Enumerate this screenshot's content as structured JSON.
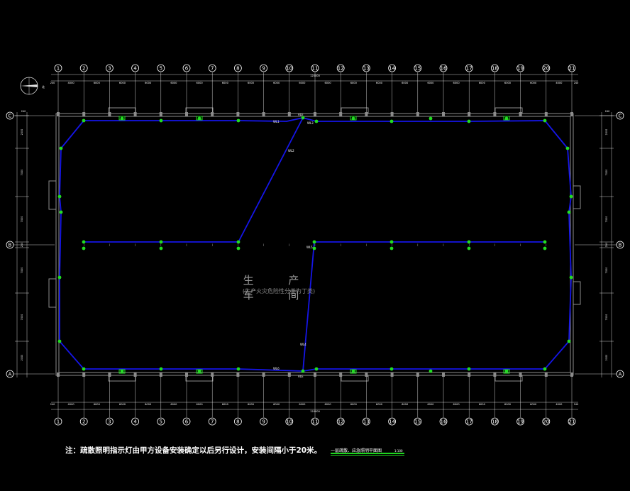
{
  "drawing": {
    "room_name": "生 产 车 间",
    "room_note": "(生产火灾危险性分类为丁类)",
    "note": "注：疏散照明指示灯由甲方设备安装确定以后另行设计，安装间隔小于20米。",
    "drawing_title": "一层疏散、应急照明平面图",
    "scale": "1:100",
    "north_label": "北"
  },
  "grid": {
    "columns": [
      "1",
      "2",
      "3",
      "4",
      "5",
      "6",
      "7",
      "8",
      "9",
      "10",
      "11",
      "12",
      "13",
      "14",
      "15",
      "16",
      "17",
      "18",
      "19",
      "20",
      "21"
    ],
    "rows": [
      "C",
      "B",
      "A"
    ],
    "spans": [
      "4000",
      "6000",
      "6000",
      "6000",
      "6000",
      "6000",
      "6000",
      "6000",
      "6000",
      "6000",
      "6000",
      "6000",
      "6000",
      "6000",
      "6000",
      "6000",
      "6000",
      "6000",
      "6000",
      "4000"
    ],
    "overall": "120000",
    "edge_offset": "240",
    "side_spans_left": [
      "2000",
      "7000",
      "7000",
      "250",
      "7000",
      "7000",
      "2000"
    ],
    "side_spans_right": [
      "2000",
      "7000",
      "7000",
      "250",
      "7000",
      "7000",
      "2000"
    ]
  },
  "circuits": {
    "labels": [
      "WL1",
      "WL2",
      "WL3",
      "WL4",
      "WL5",
      "WL6"
    ],
    "panel_labels": [
      "ALE",
      "ALE"
    ]
  },
  "colors": {
    "background": "#000000",
    "grid_lines": "#ffffff",
    "walls": "#8c8c8c",
    "circuit": "#1515e6",
    "fixture": "#22dd22"
  }
}
